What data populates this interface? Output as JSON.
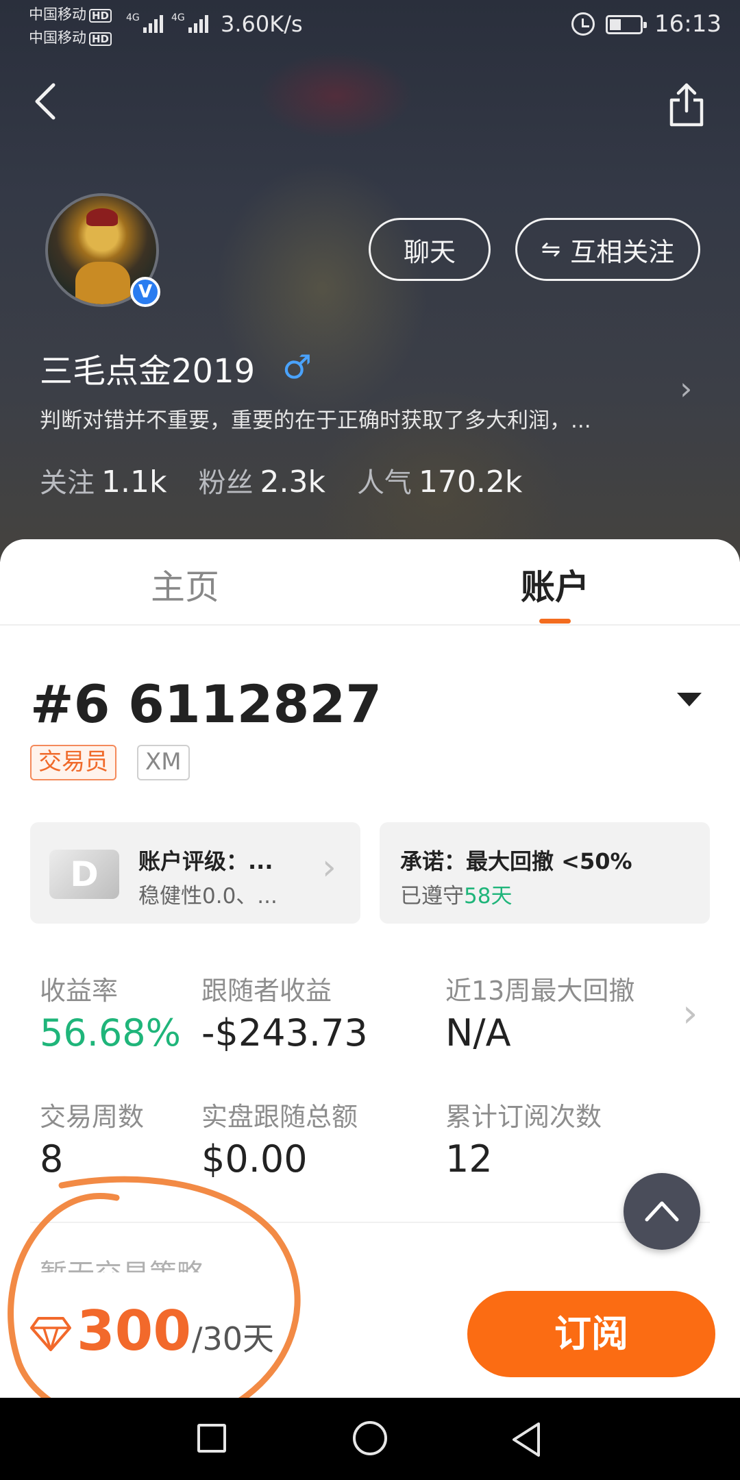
{
  "status_bar": {
    "carrier1": "中国移动",
    "carrier2": "中国移动",
    "hd": "HD",
    "net1": "4G",
    "net2": "4G",
    "speed": "3.60K/s",
    "time": "16:13"
  },
  "profile": {
    "chat_label": "聊天",
    "follow_label": "互相关注",
    "nickname": "三毛点金2019",
    "gender_symbol": "♂",
    "verified_mark": "V",
    "bio": "判断对错并不重要，重要的在于正确时获取了多大利润，...",
    "stats": [
      {
        "label": "关注",
        "value": "1.1k"
      },
      {
        "label": "粉丝",
        "value": "2.3k"
      },
      {
        "label": "人气",
        "value": "170.2k"
      }
    ]
  },
  "tabs": {
    "home": "主页",
    "account": "账户",
    "active": "account"
  },
  "account": {
    "number": "#6 6112827",
    "tag_role": "交易员",
    "tag_broker": "XM",
    "rating": {
      "grade": "D",
      "title": "账户评级：...",
      "subtitle": "稳健性0.0、..."
    },
    "promise": {
      "title": "承诺：最大回撤 <50%",
      "subtitle_prefix": "已遵守",
      "days": "58天"
    },
    "metrics": [
      {
        "label": "收益率",
        "value": "56.68%"
      },
      {
        "label": "跟随者收益",
        "value": "-$243.73"
      },
      {
        "label": "近13周最大回撤",
        "value": "N/A"
      },
      {
        "label": "交易周数",
        "value": "8"
      },
      {
        "label": "实盘跟随总额",
        "value": "$0.00"
      },
      {
        "label": "累计订阅次数",
        "value": "12"
      }
    ],
    "partial_section_text": "暂无交易策略"
  },
  "subscribe": {
    "price": "300",
    "period": "/30天",
    "button_label": "订阅"
  },
  "colors": {
    "accent_orange": "#fb6c13",
    "price_orange": "#f2692b",
    "positive_green": "#1fb57a",
    "annotation_stroke": "#f28a45"
  }
}
